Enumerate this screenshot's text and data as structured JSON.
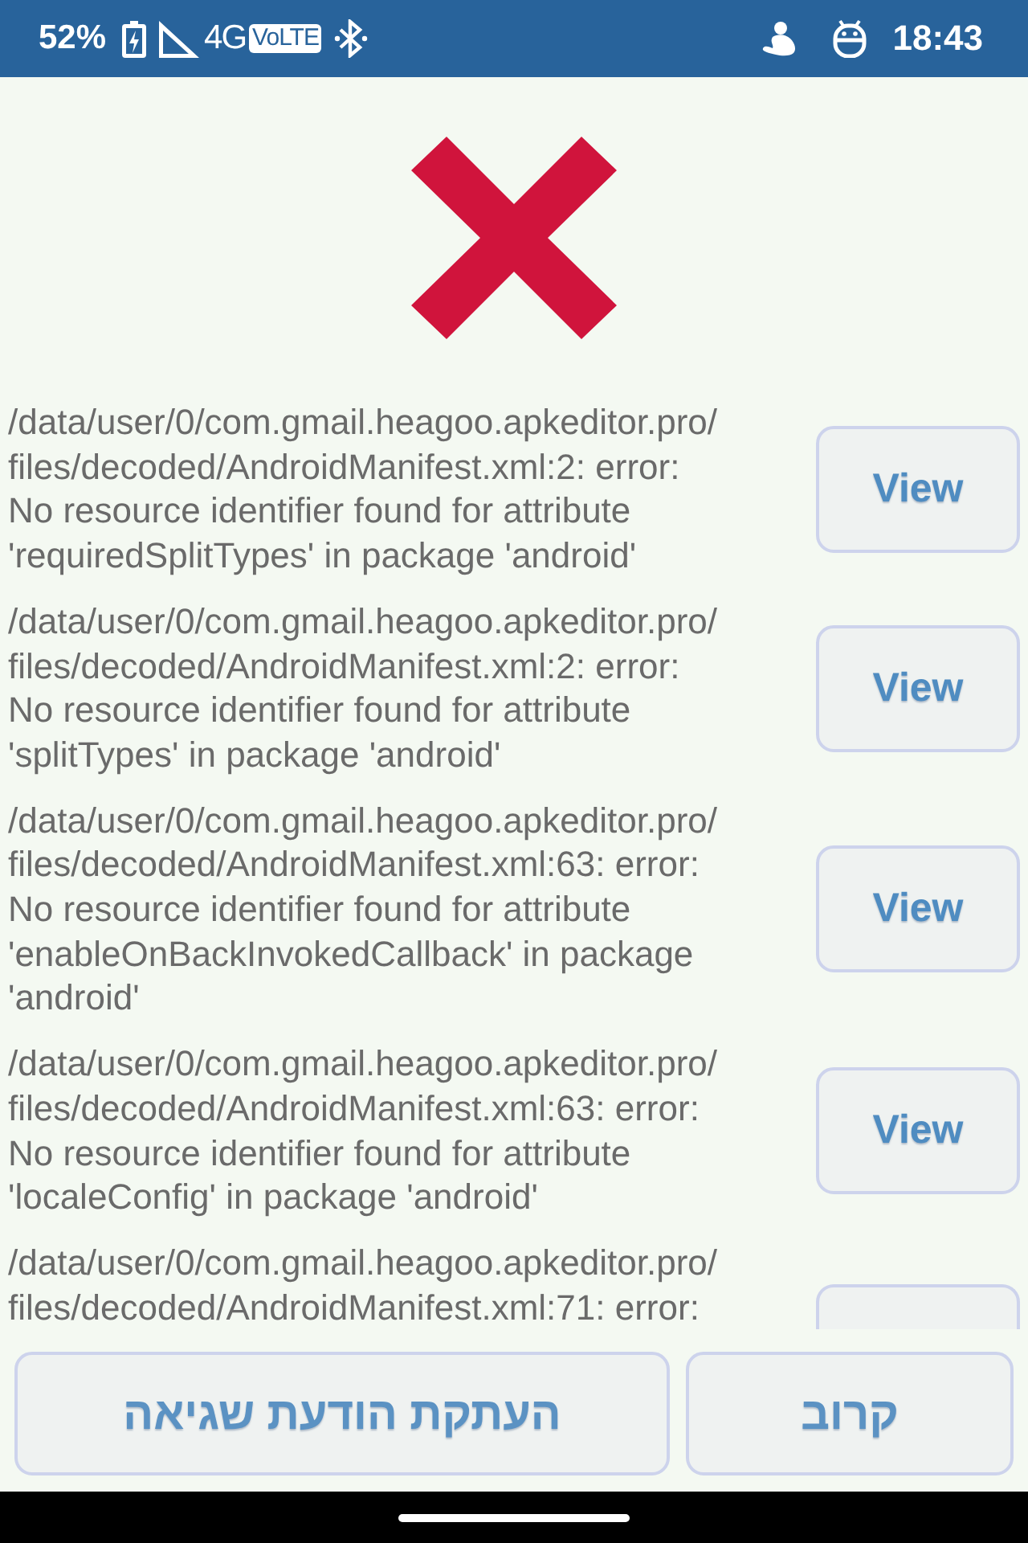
{
  "status_bar": {
    "battery_percent": "52%",
    "network": "4G",
    "volte_badge": "VoLTE",
    "time": "18:43"
  },
  "errors": [
    {
      "message": "/data/user/0/com.gmail.heagoo.apkeditor.pro/\nfiles/decoded/AndroidManifest.xml:2: error:\nNo resource identifier found for attribute\n'requiredSplitTypes' in package 'android'",
      "button": "View"
    },
    {
      "message": "/data/user/0/com.gmail.heagoo.apkeditor.pro/\nfiles/decoded/AndroidManifest.xml:2: error:\nNo resource identifier found for attribute\n'splitTypes' in package 'android'",
      "button": "View"
    },
    {
      "message": "/data/user/0/com.gmail.heagoo.apkeditor.pro/\nfiles/decoded/AndroidManifest.xml:63: error:\nNo resource identifier found for attribute\n'enableOnBackInvokedCallback' in package\n'android'",
      "button": "View"
    },
    {
      "message": "/data/user/0/com.gmail.heagoo.apkeditor.pro/\nfiles/decoded/AndroidManifest.xml:63: error:\nNo resource identifier found for attribute\n'localeConfig' in package 'android'",
      "button": "View"
    },
    {
      "message": "/data/user/0/com.gmail.heagoo.apkeditor.pro/\nfiles/decoded/AndroidManifest.xml:71: error:",
      "clipped": true
    }
  ],
  "actions": [
    {
      "label": "קרוב"
    },
    {
      "label": "העתקת הודעת שגיאה"
    }
  ]
}
